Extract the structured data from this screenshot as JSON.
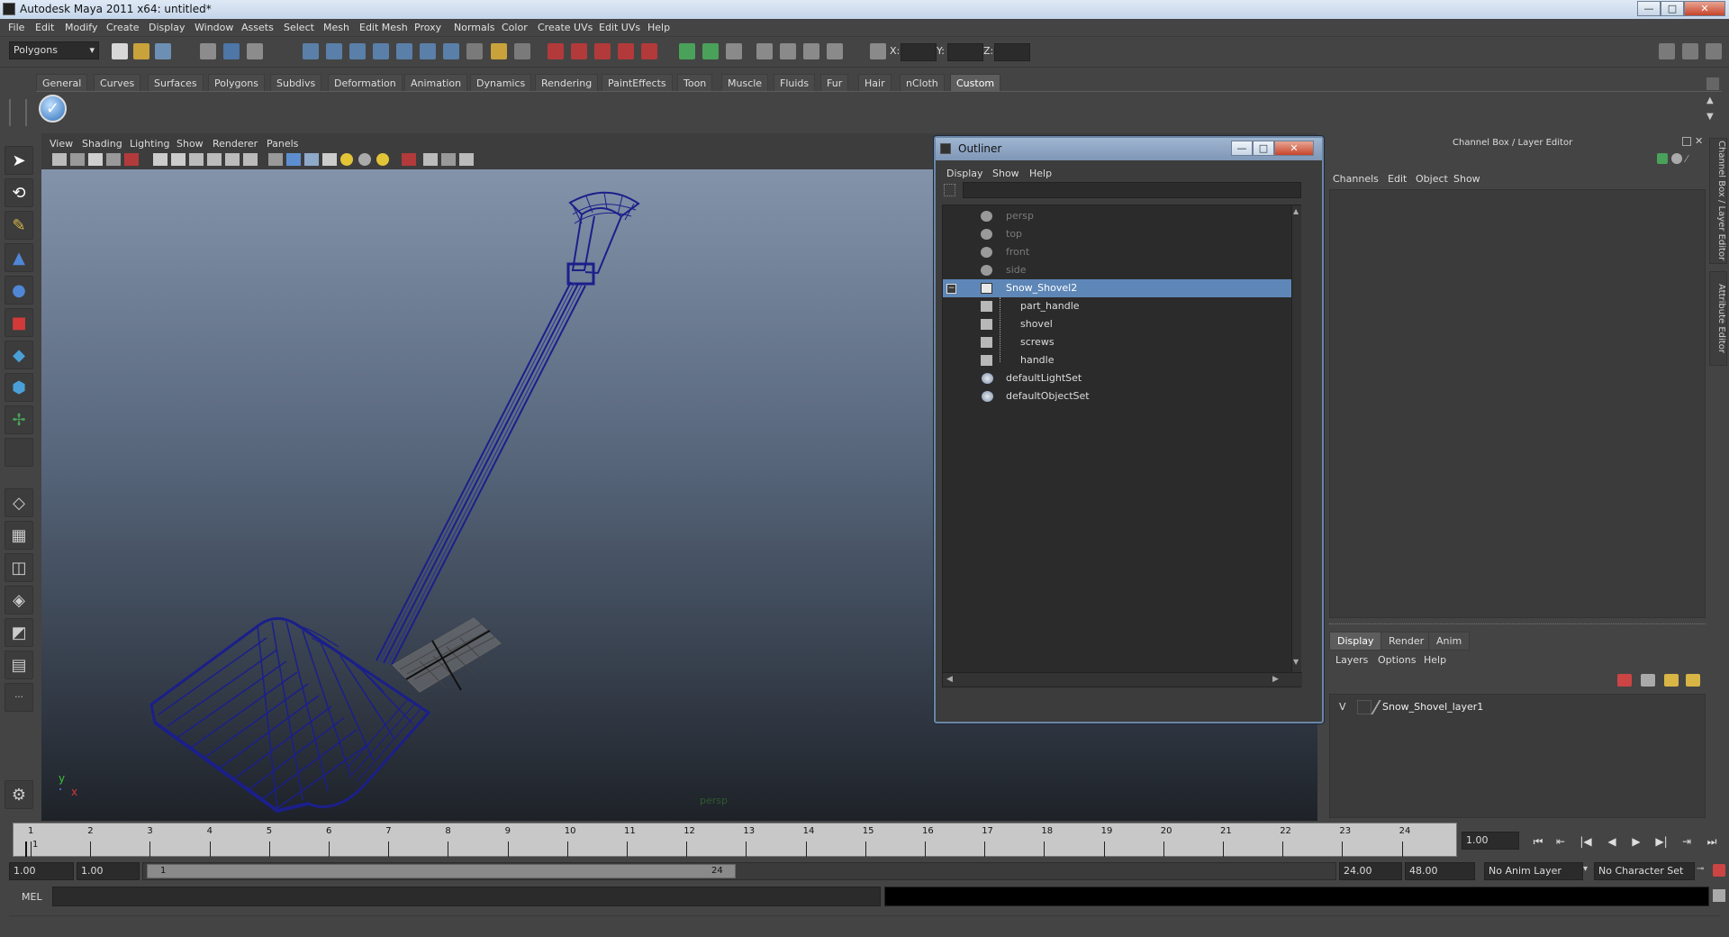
{
  "window": {
    "title": "Autodesk Maya 2011 x64: untitled*",
    "min": "—",
    "max": "□",
    "close": "✕"
  },
  "menubar": [
    "File",
    "Edit",
    "Modify",
    "Create",
    "Display",
    "Window",
    "Assets",
    "Select",
    "Mesh",
    "Edit Mesh",
    "Proxy",
    "Normals",
    "Color",
    "Create UVs",
    "Edit UVs",
    "Help"
  ],
  "statusline": {
    "menuset": "Polygons",
    "x_label": "X:",
    "y_label": "Y:",
    "z_label": "Z:"
  },
  "shelf": {
    "tabs": [
      "General",
      "Curves",
      "Surfaces",
      "Polygons",
      "Subdivs",
      "Deformation",
      "Animation",
      "Dynamics",
      "Rendering",
      "PaintEffects",
      "Toon",
      "Muscle",
      "Fluids",
      "Fur",
      "Hair",
      "nCloth",
      "Custom"
    ],
    "active": "Custom"
  },
  "viewport": {
    "menu": [
      "View",
      "Shading",
      "Lighting",
      "Show",
      "Renderer",
      "Panels"
    ],
    "camera_label": "persp",
    "axis_y": "y",
    "axis_x": "x",
    "wire_color": "#1b1f8a"
  },
  "outliner": {
    "title": "Outliner",
    "menu": [
      "Display",
      "Show",
      "Help"
    ],
    "items": [
      {
        "label": "persp",
        "dim": true
      },
      {
        "label": "top",
        "dim": true
      },
      {
        "label": "front",
        "dim": true
      },
      {
        "label": "side",
        "dim": true
      },
      {
        "label": "Snow_Shovel2",
        "selected": true
      },
      {
        "label": "part_handle",
        "child": true
      },
      {
        "label": "shovel",
        "child": true
      },
      {
        "label": "screws",
        "child": true
      },
      {
        "label": "handle",
        "child": true
      },
      {
        "label": "defaultLightSet",
        "set": true
      },
      {
        "label": "defaultObjectSet",
        "set": true
      }
    ],
    "collapse_glyph": "−"
  },
  "channelbox": {
    "title": "Channel Box / Layer Editor",
    "menu": [
      "Channels",
      "Edit",
      "Object",
      "Show"
    ],
    "layer_tabs": [
      "Display",
      "Render",
      "Anim"
    ],
    "active_layer_tab": "Display",
    "layer_menu": [
      "Layers",
      "Options",
      "Help"
    ],
    "layer": {
      "visible": "V",
      "name": "Snow_Shovel_layer1"
    },
    "side_tab_1": "Channel Box / Layer Editor",
    "side_tab_2": "Attribute Editor"
  },
  "timeslider": {
    "ticks": [
      "1",
      "2",
      "3",
      "4",
      "5",
      "6",
      "7",
      "8",
      "9",
      "10",
      "11",
      "12",
      "13",
      "14",
      "15",
      "16",
      "17",
      "18",
      "19",
      "20",
      "21",
      "22",
      "23",
      "24"
    ],
    "current_frame_marker": "1",
    "current_time": "1.00",
    "playback": [
      "⏮",
      "⇤",
      "|◀",
      "◀",
      "▶",
      "▶|",
      "⇥",
      "⏭"
    ]
  },
  "rangeslider": {
    "start_time": "1.00",
    "playback_start": "1.00",
    "range_start_label": "1",
    "range_end_label": "24",
    "playback_end": "24.00",
    "end_time": "48.00",
    "anim_layer": "No Anim Layer",
    "character_set": "No Character Set"
  },
  "cmdline": {
    "label": "MEL"
  }
}
